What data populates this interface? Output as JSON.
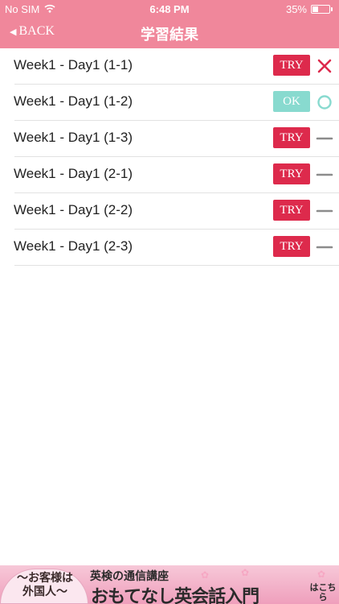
{
  "status_bar": {
    "carrier": "No SIM",
    "time": "6:48 PM",
    "battery": "35%",
    "battery_level": 0.35
  },
  "nav": {
    "back_label": "BACK",
    "title": "学習結果"
  },
  "rows": [
    {
      "label": "Week1 - Day1 (1-1)",
      "button": "TRY",
      "button_type": "try",
      "result": "x-icon"
    },
    {
      "label": "Week1 - Day1 (1-2)",
      "button": "OK",
      "button_type": "ok",
      "result": "circle-icon"
    },
    {
      "label": "Week1 - Day1 (1-3)",
      "button": "TRY",
      "button_type": "try",
      "result": "dash-icon"
    },
    {
      "label": "Week1 - Day1 (2-1)",
      "button": "TRY",
      "button_type": "try",
      "result": "dash-icon"
    },
    {
      "label": "Week1 - Day1 (2-2)",
      "button": "TRY",
      "button_type": "try",
      "result": "dash-icon"
    },
    {
      "label": "Week1 - Day1 (2-3)",
      "button": "TRY",
      "button_type": "try",
      "result": "dash-icon"
    }
  ],
  "ad": {
    "left_line1": "〜お客様は",
    "left_line2": "外国人〜",
    "top_text": "英検の通信講座",
    "main_text": "おもてなし英会話入門",
    "kochira": "はこちら"
  },
  "colors": {
    "header": "#f0879b",
    "try_button": "#dd2a4c",
    "ok_button": "#88dacf",
    "x_icon": "#dd2a4c",
    "circle_icon": "#88dacf",
    "dash_icon": "#8c8c8c"
  }
}
